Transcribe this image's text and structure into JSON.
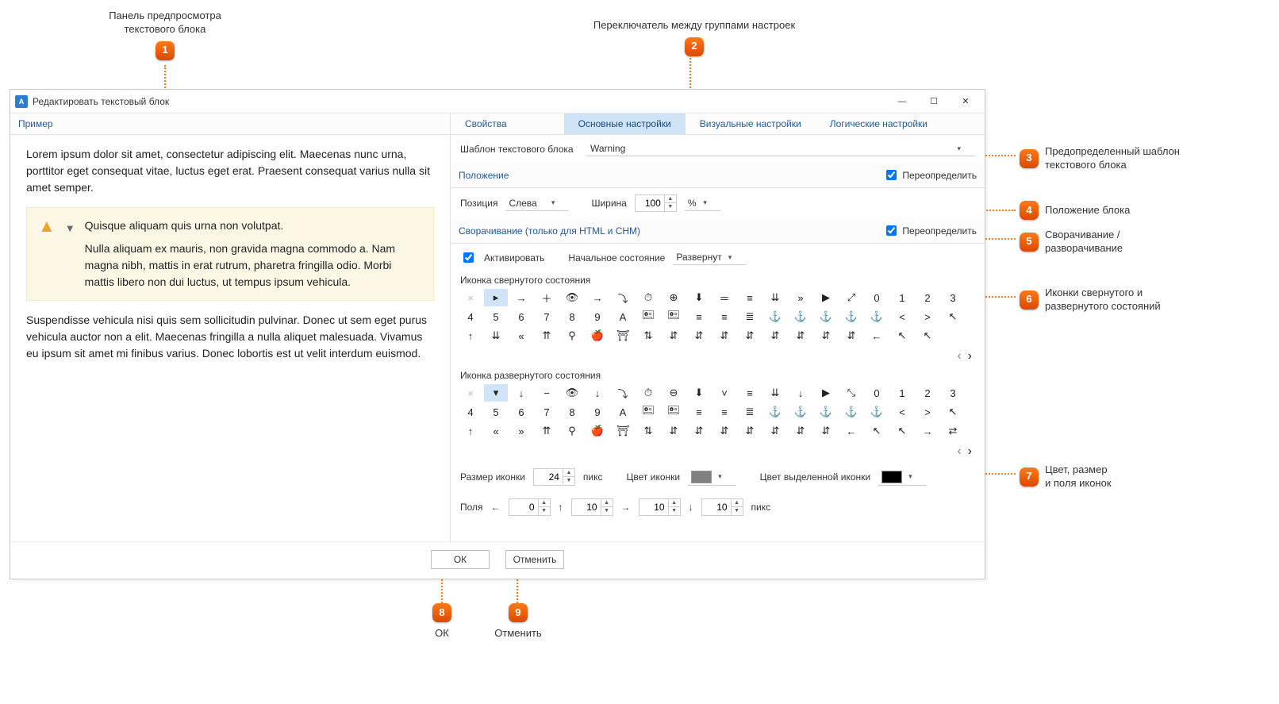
{
  "annotations": {
    "a1": {
      "num": "1",
      "text": "Панель предпросмотра\nтекстового блока"
    },
    "a2": {
      "num": "2",
      "text": "Переключатель между группами настроек"
    },
    "a3": {
      "num": "3",
      "text": "Предопределенный шаблон\nтекстового блока"
    },
    "a4": {
      "num": "4",
      "text": "Положение блока"
    },
    "a5": {
      "num": "5",
      "text": "Сворачивание /\nразворачивание"
    },
    "a6": {
      "num": "6",
      "text": "Иконки свернутого и\nразвернутого состояний"
    },
    "a7": {
      "num": "7",
      "text": "Цвет, размер\nи поля иконок"
    },
    "a8": {
      "num": "8",
      "text": "ОК"
    },
    "a9": {
      "num": "9",
      "text": "Отменить"
    }
  },
  "titlebar": {
    "title": "Редактировать текстовый блок",
    "min": "—",
    "max": "☐",
    "close": "✕"
  },
  "preview": {
    "header": "Пример",
    "p1": "Lorem ipsum dolor sit amet, consectetur adipiscing elit. Maecenas nunc urna, porttitor eget consequat vitae, luctus eget erat. Praesent consequat varius nulla sit amet semper.",
    "box_title": "Quisque aliquam quis urna non volutpat.",
    "box_body": "Nulla aliquam ex mauris, non gravida magna commodo a. Nam magna nibh, mattis in erat rutrum, pharetra fringilla odio. Morbi mattis libero non dui luctus, ut tempus ipsum vehicula.",
    "p2": "Suspendisse vehicula nisi quis sem sollicitudin pulvinar. Donec ut sem eget purus vehicula auctor non a elit. Maecenas fringilla a nulla aliquet malesuada. Vivamus eu ipsum sit amet mi finibus varius. Donec lobortis est ut velit interdum euismod."
  },
  "tabs": {
    "t0": "Свойства",
    "t1": "Основные настройки",
    "t2": "Визуальные настройки",
    "t3": "Логические настройки"
  },
  "template": {
    "label": "Шаблон текстового блока",
    "value": "Warning"
  },
  "position": {
    "header": "Положение",
    "override": "Переопределить",
    "override_checked": true,
    "pos_label": "Позиция",
    "pos_value": "Слева",
    "width_label": "Ширина",
    "width_value": "100",
    "width_unit": "%"
  },
  "collapse": {
    "header": "Сворачивание (только для HTML и CHM)",
    "override": "Переопределить",
    "override_checked": true,
    "activate_label": "Активировать",
    "activate_checked": true,
    "initial_label": "Начальное состояние",
    "initial_value": "Развернут",
    "collapsed_icon_label": "Иконка свернутого состояния",
    "expanded_icon_label": "Иконка развернутого состояния"
  },
  "icon_rows_collapsed": [
    [
      "×",
      "▸",
      "→",
      "＋",
      "👁",
      "→",
      "⤵",
      "⏱",
      "⊕",
      "⬇",
      "＝",
      "≡",
      "⇊",
      "»",
      "▶",
      "⤢",
      "0",
      "1",
      "2",
      "3"
    ],
    [
      "4",
      "5",
      "6",
      "7",
      "8",
      "9",
      "A",
      "🖭",
      "🖭",
      "≡",
      "≡",
      "≣",
      "⚓",
      "⚓",
      "⚓",
      "⚓",
      "⚓",
      "<",
      ">",
      "↖"
    ],
    [
      "↑",
      "⇊",
      "«",
      "⇈",
      "⚲",
      "🍎",
      "⛩",
      "⇅",
      "⇵",
      "⇵",
      "⇵",
      "⇵",
      "⇵",
      "⇵",
      "⇵",
      "⇵",
      "←",
      "↖",
      "↖",
      ""
    ]
  ],
  "icon_rows_expanded": [
    [
      "×",
      "▾",
      "↓",
      "−",
      "👁",
      "↓",
      "⤵",
      "⏱",
      "⊖",
      "⬇",
      "˅",
      "≡",
      "⇊",
      "↓",
      "▶",
      "⤡",
      "0",
      "1",
      "2",
      "3"
    ],
    [
      "4",
      "5",
      "6",
      "7",
      "8",
      "9",
      "A",
      "🖭",
      "🖭",
      "≡",
      "≡",
      "≣",
      "⚓",
      "⚓",
      "⚓",
      "⚓",
      "⚓",
      "<",
      ">",
      "↖"
    ],
    [
      "↑",
      "«",
      "»",
      "⇈",
      "⚲",
      "🍎",
      "⛩",
      "⇅",
      "⇵",
      "⇵",
      "⇵",
      "⇵",
      "⇵",
      "⇵",
      "⇵",
      "←",
      "↖",
      "↖",
      "→",
      "⇄"
    ]
  ],
  "icon_props": {
    "size_label": "Размер иконки",
    "size_value": "24",
    "px": "пикс",
    "color_label": "Цвет иконки",
    "color_value": "#808080",
    "hl_label": "Цвет выделенной иконки",
    "hl_value": "#000000",
    "margins_label": "Поля",
    "m_left": "0",
    "m_top": "10",
    "m_right": "10",
    "m_bottom": "10"
  },
  "footer": {
    "ok": "ОК",
    "cancel": "Отменить"
  }
}
